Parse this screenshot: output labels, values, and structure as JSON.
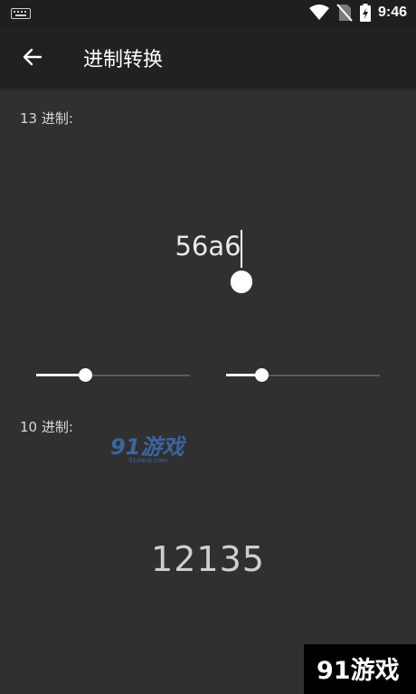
{
  "status_bar": {
    "time": "9:46"
  },
  "app_bar": {
    "title": "进制转换"
  },
  "converter": {
    "source_label": "13 进制:",
    "input_value": "56a6",
    "target_label": "10 进制:",
    "result_value": "12135"
  },
  "sliders": {
    "source_base_fraction": 0.32,
    "target_base_fraction": 0.23
  },
  "watermark": {
    "brand": "91游戏",
    "site": "91danji.com"
  },
  "colors": {
    "background": "#303030",
    "app_bar": "#212121",
    "status_bar": "#1f1f1f",
    "accent": "#ffffff"
  }
}
